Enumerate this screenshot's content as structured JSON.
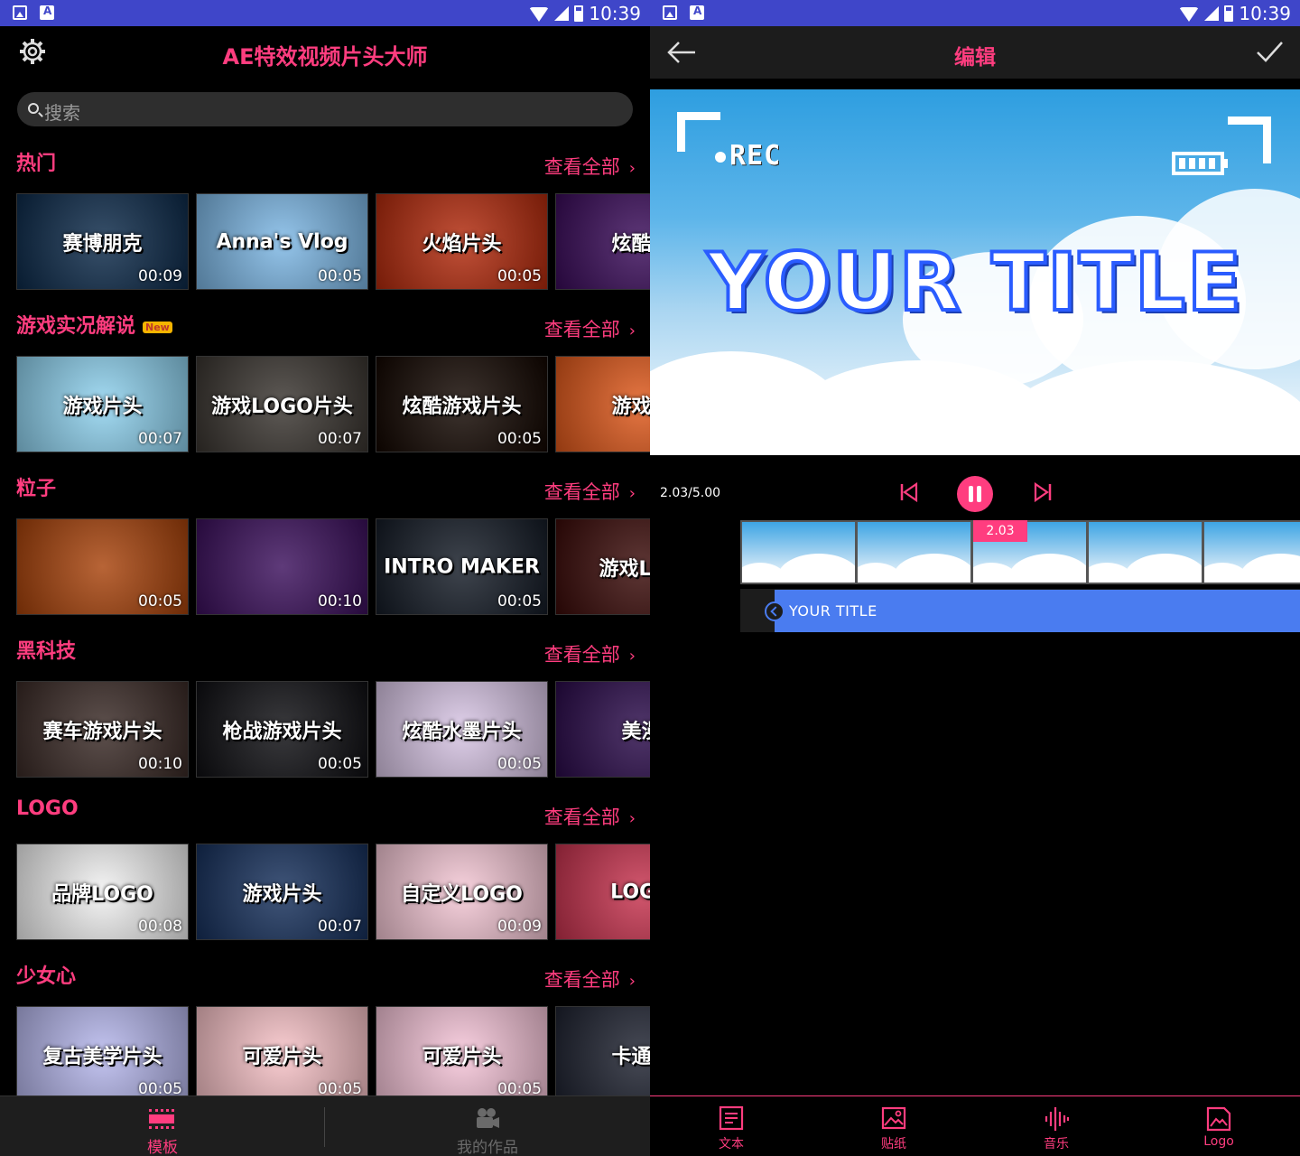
{
  "status_bar": {
    "time": "10:39"
  },
  "left": {
    "app_title": "AE特效视频片头大师",
    "search_placeholder": "搜索",
    "see_all": "查看全部",
    "sections": [
      {
        "title": "热门",
        "badge": "",
        "thumbs": [
          {
            "title": "赛博朋克",
            "duration": "00:09",
            "bg": "#0c2a4a"
          },
          {
            "title": "Anna's Vlog",
            "duration": "00:05",
            "bg": "#7db8e6"
          },
          {
            "title": "火焰片头",
            "duration": "00:05",
            "bg": "#b42a0c"
          },
          {
            "title": "炫酷片",
            "duration": "",
            "bg": "#3a0b5a"
          }
        ]
      },
      {
        "title": "游戏实况解说",
        "badge": "New",
        "thumbs": [
          {
            "title": "游戏片头",
            "duration": "00:07",
            "bg": "#8fd3f0"
          },
          {
            "title": "游戏LOGO片头",
            "duration": "00:07",
            "bg": "#3a3530"
          },
          {
            "title": "炫酷游戏片头",
            "duration": "00:05",
            "bg": "#120600"
          },
          {
            "title": "游戏片",
            "duration": "",
            "bg": "#e0581a"
          }
        ]
      },
      {
        "title": "粒子",
        "badge": "",
        "thumbs": [
          {
            "title": "",
            "duration": "00:05",
            "bg": "#a8420a"
          },
          {
            "title": "",
            "duration": "00:10",
            "bg": "#3b0f5c"
          },
          {
            "title": "INTRO MAKER",
            "duration": "00:05",
            "bg": "#141b26"
          },
          {
            "title": "游戏LOG",
            "duration": "",
            "bg": "#3a0a08"
          }
        ]
      },
      {
        "title": "黑科技",
        "badge": "",
        "thumbs": [
          {
            "title": "赛车游戏片头",
            "duration": "00:10",
            "bg": "#3a2a26"
          },
          {
            "title": "枪战游戏片头",
            "duration": "00:05",
            "bg": "#0e0e12"
          },
          {
            "title": "炫酷水墨片头",
            "duration": "00:05",
            "bg": "#d9c6e6"
          },
          {
            "title": "美漫",
            "duration": "",
            "bg": "#2a0a4a"
          }
        ]
      },
      {
        "title": "LOGO",
        "badge": "",
        "thumbs": [
          {
            "title": "品牌LOGO",
            "duration": "00:08",
            "bg": "#f3f3f3"
          },
          {
            "title": "游戏片头",
            "duration": "00:07",
            "bg": "#16305c"
          },
          {
            "title": "自定义LOGO",
            "duration": "00:09",
            "bg": "#f6c8d6"
          },
          {
            "title": "LOGO",
            "duration": "",
            "bg": "#c8324e"
          }
        ]
      },
      {
        "title": "少女心",
        "badge": "",
        "thumbs": [
          {
            "title": "复古美学片头",
            "duration": "00:05",
            "bg": "#b7b8ee"
          },
          {
            "title": "可爱片头",
            "duration": "00:05",
            "bg": "#f9c3c8"
          },
          {
            "title": "可爱片头",
            "duration": "00:05",
            "bg": "#f8c6da"
          },
          {
            "title": "卡通片",
            "duration": "",
            "bg": "#1e2230"
          }
        ]
      }
    ],
    "nav": {
      "templates": "模板",
      "my_works": "我的作品"
    }
  },
  "right": {
    "title": "编辑",
    "preview": {
      "rec_label": "REC",
      "title_text": "YOUR  TITLE"
    },
    "time_readout": "2.03/5.00",
    "playhead_label": "2.03",
    "text_track_label": "YOUR TITLE",
    "nav": {
      "text": "文本",
      "sticker": "贴纸",
      "music": "音乐",
      "logo": "Logo"
    }
  },
  "colors": {
    "accent": "#ff3d7f",
    "status_bar": "#3f46c9",
    "track": "#4a7cf0"
  }
}
